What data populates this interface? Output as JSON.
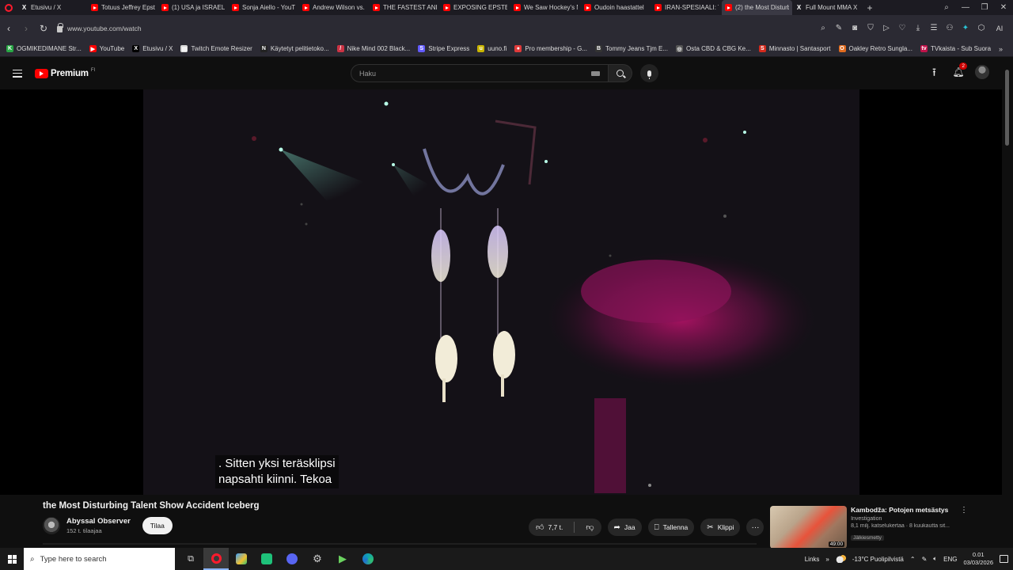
{
  "browser": {
    "tabs": [
      {
        "label": "Etusivu / X",
        "icon": "x-icon",
        "active": false
      },
      {
        "label": "Totuus Jeffrey Epste",
        "icon": "youtube-icon",
        "active": false
      },
      {
        "label": "(1) USA ja ISRAEL T",
        "icon": "youtube-icon",
        "active": false
      },
      {
        "label": "Sonja Aiello - YouT",
        "icon": "youtube-icon",
        "active": false
      },
      {
        "label": "Andrew Wilson vs.",
        "icon": "youtube-icon",
        "active": false
      },
      {
        "label": "THE FASTEST ANIM",
        "icon": "youtube-icon",
        "active": false
      },
      {
        "label": "EXPOSING EPSTEIN",
        "icon": "youtube-icon",
        "active": false
      },
      {
        "label": "We Saw Hockey's N",
        "icon": "youtube-icon",
        "active": false
      },
      {
        "label": "Oudoin haastattel",
        "icon": "youtube-icon",
        "active": false
      },
      {
        "label": "IRAN-SPESIAALI: Tr",
        "icon": "youtube-icon",
        "active": false
      },
      {
        "label": "(2) the Most Disturbin",
        "icon": "youtube-icon",
        "active": true
      },
      {
        "label": "Full Mount MMA X",
        "icon": "x-icon",
        "active": false
      }
    ],
    "url": "www.youtube.com/watch",
    "ai_label": "AI",
    "bookmarks": [
      {
        "label": "OGMIKEDIMANE Str...",
        "color": "#28a745",
        "glyph": "K"
      },
      {
        "label": "YouTube",
        "color": "#ff0000",
        "glyph": "▶"
      },
      {
        "label": "Etusivu / X",
        "color": "#000000",
        "glyph": "X"
      },
      {
        "label": "Twitch Emote Resizer",
        "color": "#d8d8d8",
        "glyph": "▤"
      },
      {
        "label": "Käytetyt pelitietoko...",
        "color": "#222222",
        "glyph": "N"
      },
      {
        "label": "Nike Mind 002 Black...",
        "color": "#cc3344",
        "glyph": "/"
      },
      {
        "label": "Stripe Express",
        "color": "#635bff",
        "glyph": "S"
      },
      {
        "label": "uuno.fi",
        "color": "#c8b400",
        "glyph": "u"
      },
      {
        "label": "Pro membership - G...",
        "color": "#e03a3a",
        "glyph": "●"
      },
      {
        "label": "Tommy Jeans Tjm E...",
        "color": "#333333",
        "glyph": "B"
      },
      {
        "label": "Osta CBD & CBG Ke...",
        "color": "#555555",
        "glyph": "◎"
      },
      {
        "label": "Minnasto | Santasport",
        "color": "#d52b1e",
        "glyph": "S"
      },
      {
        "label": "Oakley Retro Sungla...",
        "color": "#e06b1f",
        "glyph": "O"
      },
      {
        "label": "TVkaista - Sub Suora",
        "color": "#c0134a",
        "glyph": "tv"
      }
    ]
  },
  "youtube": {
    "logo_text": "Premium",
    "region": "FI",
    "search_placeholder": "Haku",
    "notification_count": "2",
    "caption_lines": [
      ". Sitten yksi teräsklipsi",
      "napsahti kiinni. Tekoa"
    ],
    "video_title": "the Most Disturbing Talent Show Accident Iceberg",
    "channel_name": "Abyssal Observer",
    "channel_subs": "152 t. tilaajaa",
    "subscribe_label": "Tilaa",
    "like_count": "7,7 t.",
    "share_label": "Jaa",
    "save_label": "Tallenna",
    "clip_label": "Klippi",
    "recommended": {
      "title": "Kambodža: Potojen metsästys",
      "channel": "Investigation",
      "stats": "8,1 milj. katselukertaa · 8 kuukautta sit...",
      "badge": "Jälkiesmetty",
      "duration": "49:00"
    }
  },
  "taskbar": {
    "search_placeholder": "Type here to search",
    "links_label": "Links",
    "weather": "-13°C  Puolipilvistä",
    "language": "ENG",
    "time": "0.01",
    "date": "03/03/2026"
  },
  "colors": {
    "yt_red": "#ff0000",
    "browser_accent": "#ff1b2d",
    "dark_bg": "#0f0f0f"
  }
}
